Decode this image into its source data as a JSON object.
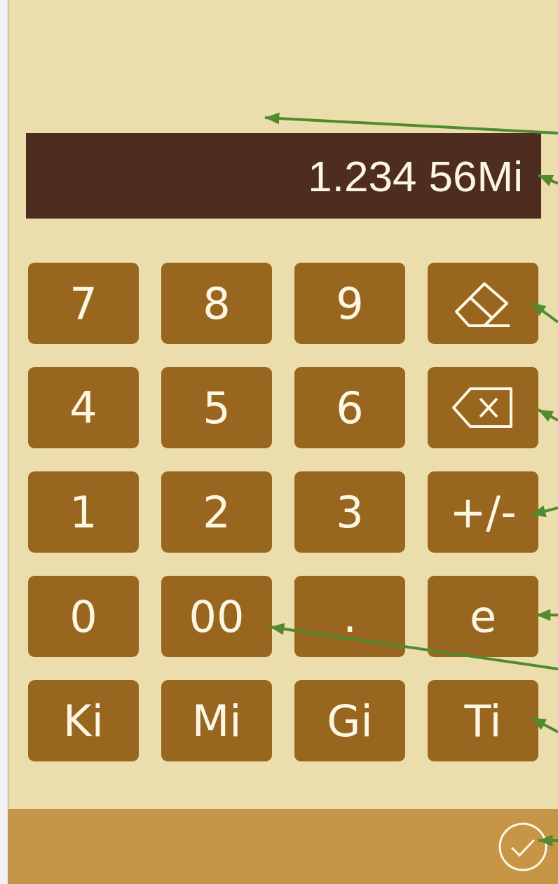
{
  "display": {
    "value": "1.234 56Mi"
  },
  "keys": [
    {
      "kind": "text",
      "label": "7"
    },
    {
      "kind": "text",
      "label": "8"
    },
    {
      "kind": "text",
      "label": "9"
    },
    {
      "kind": "eraser"
    },
    {
      "kind": "text",
      "label": "4"
    },
    {
      "kind": "text",
      "label": "5"
    },
    {
      "kind": "text",
      "label": "6"
    },
    {
      "kind": "backspace"
    },
    {
      "kind": "text",
      "label": "1"
    },
    {
      "kind": "text",
      "label": "2"
    },
    {
      "kind": "text",
      "label": "3"
    },
    {
      "kind": "text",
      "label": "+/-"
    },
    {
      "kind": "text",
      "label": "0"
    },
    {
      "kind": "text",
      "label": "00"
    },
    {
      "kind": "text",
      "label": "."
    },
    {
      "kind": "text",
      "label": "e"
    },
    {
      "kind": "text",
      "label": "Ki"
    },
    {
      "kind": "text",
      "label": "Mi"
    },
    {
      "kind": "text",
      "label": "Gi"
    },
    {
      "kind": "text",
      "label": "Ti"
    }
  ]
}
